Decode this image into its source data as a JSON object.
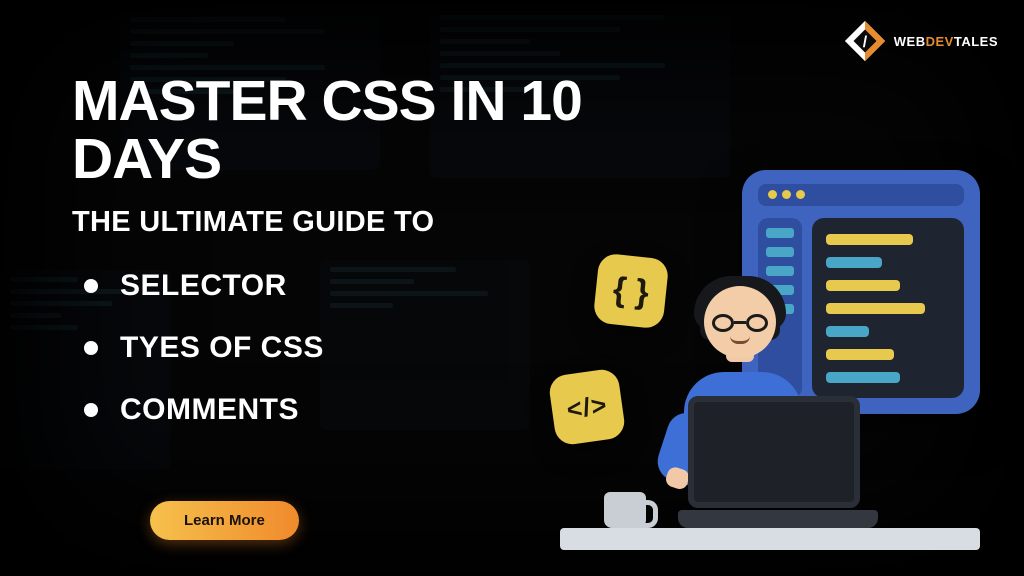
{
  "logo": {
    "brand_a": "WEB",
    "brand_b": "DEV",
    "brand_c": "TALES"
  },
  "headline": {
    "title": "MASTER CSS IN 10 DAYS",
    "subtitle": "THE ULTIMATE GUIDE TO",
    "bullets": [
      "SELECTOR",
      "TYES OF CSS",
      "COMMENTS"
    ]
  },
  "cta": {
    "learn_more": "Learn More"
  },
  "icons": {
    "chip_braces": "{ }",
    "chip_code": "</>"
  },
  "colors": {
    "accent_yellow": "#e7c94d",
    "accent_orange": "#f08a2c",
    "brand_blue": "#3f64c0"
  }
}
